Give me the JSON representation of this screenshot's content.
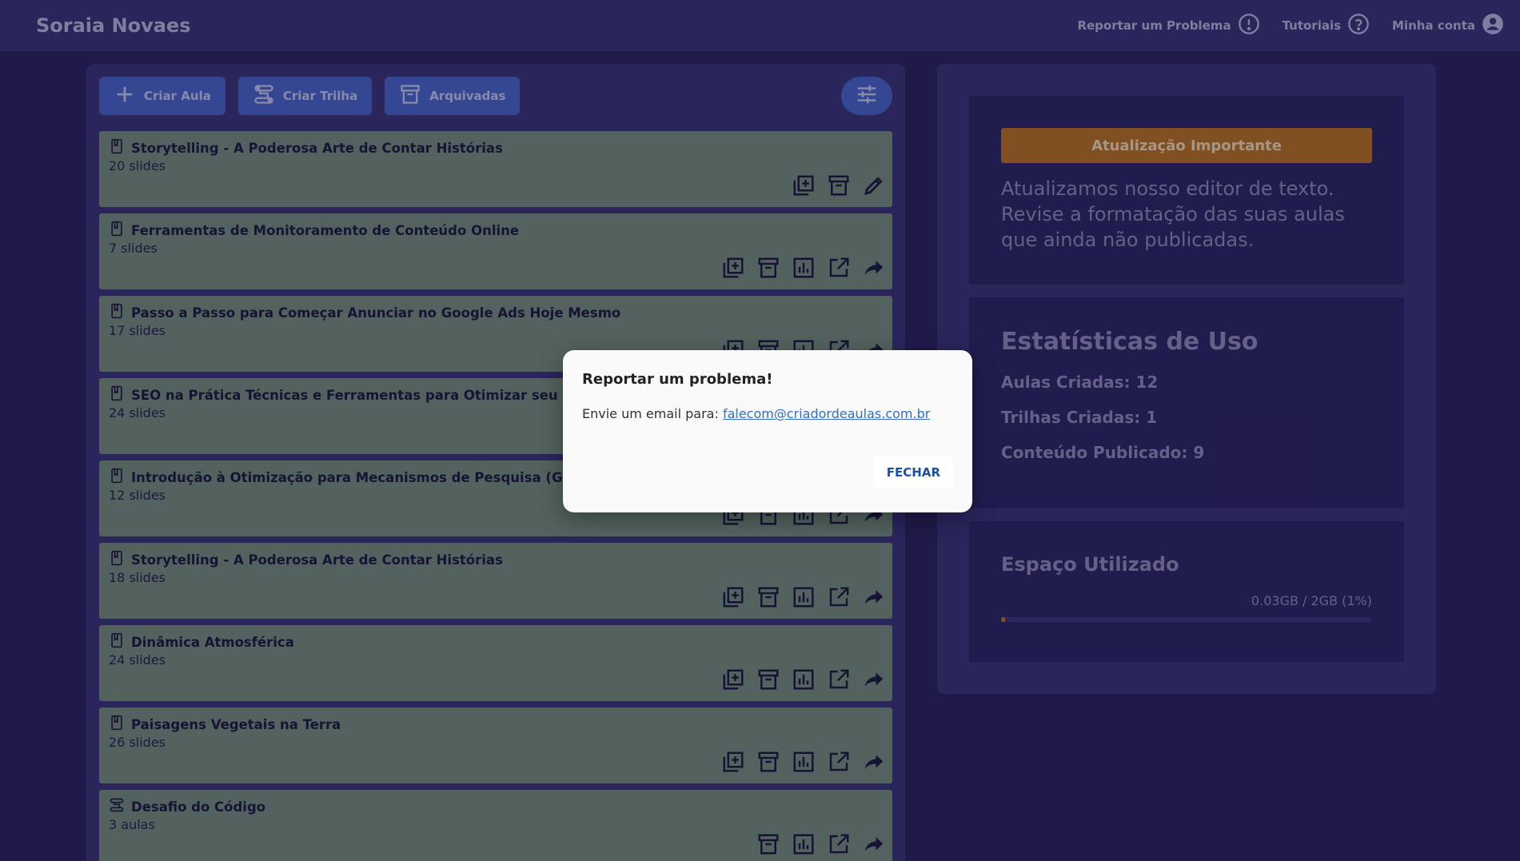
{
  "header": {
    "brand": "Soraia Novaes",
    "nav": [
      {
        "label": "Reportar um Problema",
        "icon": "alert-circle-icon"
      },
      {
        "label": "Tutoriais",
        "icon": "help-circle-icon"
      },
      {
        "label": "Minha conta",
        "icon": "account-circle-icon"
      }
    ]
  },
  "toolbar": {
    "create_class": "Criar Aula",
    "create_track": "Criar Trilha",
    "archived": "Arquivadas"
  },
  "lessons": [
    {
      "title": "Storytelling - A Poderosa Arte de Contar Histórias",
      "sub": "20 slides"
    },
    {
      "title": "Ferramentas de Monitoramento de Conteúdo Online",
      "sub": "7 slides"
    },
    {
      "title": "Passo a Passo para Começar Anunciar no Google Ads Hoje Mesmo",
      "sub": "17 slides"
    },
    {
      "title": "SEO na Prática Técnicas e Ferramentas para Otimizar seu Site",
      "sub": "24 slides"
    },
    {
      "title": "Introdução à Otimização para Mecanismos de Pesquisa (Google)",
      "sub": "12 slides"
    },
    {
      "title": "Storytelling - A Poderosa Arte de Contar Histórias",
      "sub": "18 slides"
    },
    {
      "title": "Dinâmica Atmosférica",
      "sub": "24 slides"
    },
    {
      "title": "Paisagens Vegetais na Terra",
      "sub": "26 slides"
    },
    {
      "title": "Desafio do Código",
      "sub": "3 aulas"
    }
  ],
  "update": {
    "button": "Atualização Importante",
    "text": "Atualizamos nosso editor de texto. Revise a formatação das suas aulas que ainda não publicadas."
  },
  "stats": {
    "title": "Estatísticas de Uso",
    "classes": "Aulas Criadas: 12",
    "tracks": "Trilhas Criadas: 1",
    "published": "Conteúdo Publicado: 9"
  },
  "storage": {
    "title": "Espaço Utilizado",
    "value": "0.03GB / 2GB (1%)",
    "percent": 1
  },
  "modal": {
    "title": "Reportar um problema!",
    "body_prefix": "Envie um email para: ",
    "email": "falecom@criadordeaulas.com.br",
    "close": "FECHAR"
  },
  "colors": {
    "accent": "#4b63c4",
    "card": "#778c78",
    "warning": "#b9721f"
  }
}
